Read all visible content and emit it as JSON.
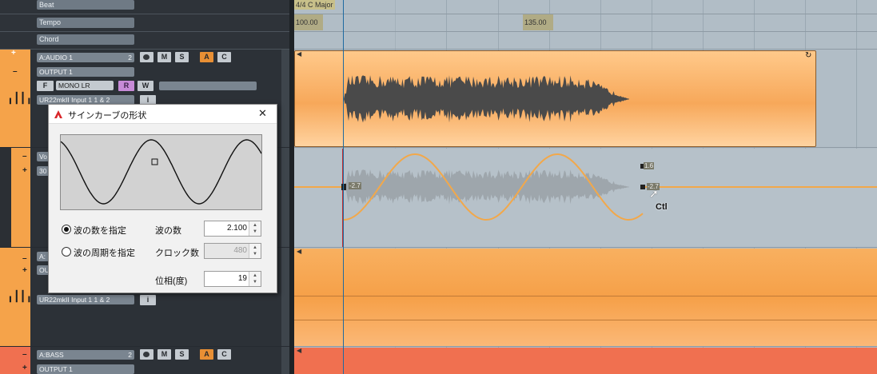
{
  "global_lanes": {
    "beat_label": "Beat",
    "tempo_label": "Tempo",
    "chord_label": "Chord"
  },
  "ruler": {
    "signature": "4/4 C Major",
    "tempo_1": "100.00",
    "tempo_2": "135.00"
  },
  "tracks": [
    {
      "name": "A:AUDIO 1",
      "number": "2",
      "output": "OUTPUT 1",
      "input": "UR22mkII Input 1 1 & 2",
      "mono_label": "MONO LR",
      "buttons": [
        "M",
        "S",
        "A",
        "C"
      ],
      "mix_buttons": [
        "F",
        "R",
        "W"
      ],
      "info_label": "i"
    },
    {
      "name_partial": "Vo",
      "value_partial": "30"
    },
    {
      "name_partial": "A:",
      "output_partial": "OU",
      "input": "UR22mkII Input 1 1 & 2",
      "info_label": "i"
    },
    {
      "name": "A:BASS",
      "number": "2",
      "output": "OUTPUT 1",
      "buttons": [
        "M",
        "S",
        "A",
        "C"
      ]
    }
  ],
  "envelope": {
    "start_value": "-2.7",
    "point_high": "1.6",
    "point_low": "-2.7",
    "cursor_label": "Ctl"
  },
  "dialog": {
    "title": "サインカーブの形状",
    "close_label": "✕",
    "radio_count_label": "波の数を指定",
    "radio_period_label": "波の周期を指定",
    "wave_count_label": "波の数",
    "wave_count_value": "2.100",
    "clock_label": "クロック数",
    "clock_value": "480",
    "phase_label": "位相(度)",
    "phase_value": "19"
  },
  "colors": {
    "accent_orange": "#f5a34a",
    "bass_red": "#f07050",
    "curve": "#f2a84a"
  }
}
